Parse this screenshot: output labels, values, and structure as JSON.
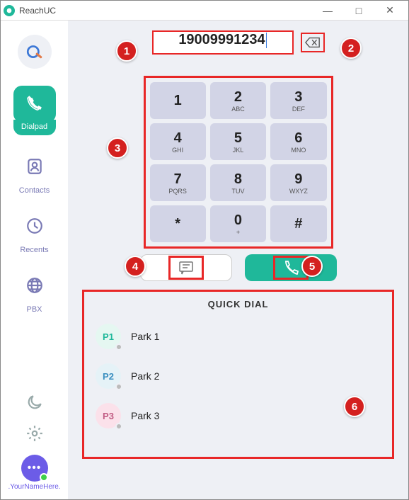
{
  "app": {
    "title": "ReachUC"
  },
  "window": {
    "min": "—",
    "max": "□",
    "close": "✕"
  },
  "sidebar": {
    "items": [
      {
        "label": "Dialpad"
      },
      {
        "label": "Contacts"
      },
      {
        "label": "Recents"
      },
      {
        "label": "PBX"
      }
    ]
  },
  "profile": {
    "name": ".YourNameHere."
  },
  "dialer": {
    "number": "19009991234",
    "keys": [
      {
        "d": "1",
        "l": ""
      },
      {
        "d": "2",
        "l": "ABC"
      },
      {
        "d": "3",
        "l": "DEF"
      },
      {
        "d": "4",
        "l": "GHI"
      },
      {
        "d": "5",
        "l": "JKL"
      },
      {
        "d": "6",
        "l": "MNO"
      },
      {
        "d": "7",
        "l": "PQRS"
      },
      {
        "d": "8",
        "l": "TUV"
      },
      {
        "d": "9",
        "l": "WXYZ"
      },
      {
        "d": "*",
        "l": ""
      },
      {
        "d": "0",
        "l": "+"
      },
      {
        "d": "#",
        "l": ""
      }
    ]
  },
  "quickdial": {
    "title": "QUICK DIAL",
    "items": [
      {
        "code": "P1",
        "label": "Park 1",
        "bg": "#e5f7f1",
        "fg": "#1fb89a"
      },
      {
        "code": "P2",
        "label": "Park 2",
        "bg": "#e5f2f7",
        "fg": "#3a8fc0"
      },
      {
        "code": "P3",
        "label": "Park 3",
        "bg": "#fbe1ea",
        "fg": "#c25d84"
      }
    ]
  },
  "annotations": {
    "b1": "1",
    "b2": "2",
    "b3": "3",
    "b4": "4",
    "b5": "5",
    "b6": "6"
  }
}
